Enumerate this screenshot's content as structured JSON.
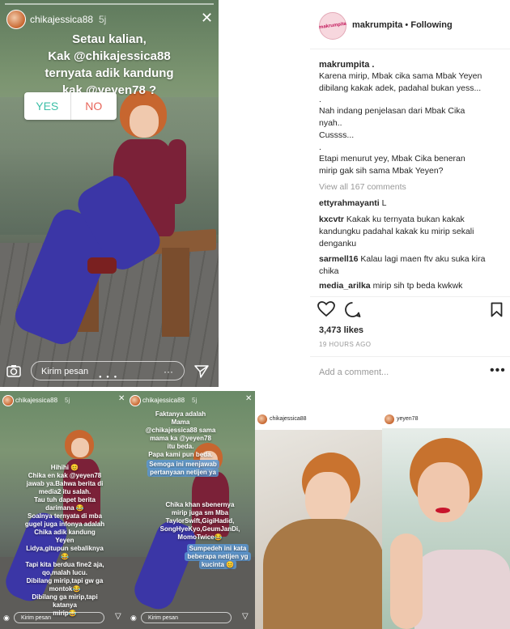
{
  "main_story": {
    "username": "chikajessica88",
    "time": "5j",
    "question": [
      "Setau kalian,",
      "Kak @chikajessica88",
      "ternyata adik kandung",
      "kak @yeyen78 ?"
    ],
    "poll_yes": "YES",
    "poll_no": "NO",
    "reply_placeholder": "Kirim pesan"
  },
  "post": {
    "username": "makrumpita",
    "follow_state": "Following",
    "logo_text": "makrumpita",
    "caption_user": "makrumpita .",
    "caption_lines": [
      "Karena mirip, Mbak cika sama Mbak Yeyen",
      "dibilang kakak adek, padahal bukan yess...",
      ".",
      "Nah indang penjelasan dari Mbak Cika",
      "nyah..",
      "Cussss...",
      ".",
      "Etapi menurut yey, Mbak Cika beneran",
      "mirip gak sih sama Mbak Yeyen?"
    ],
    "view_all": "View all 167 comments",
    "comments": [
      {
        "user": "ettyrahmayanti",
        "text": "L"
      },
      {
        "user": "kxcvtr",
        "text": "Kakak ku ternyata bukan kakak kandungku padahal kakak ku mirip sekali denganku"
      },
      {
        "user": "sarmell16",
        "text": "Kalau lagi maen ftv aku suka kira chika"
      },
      {
        "user": "media_arilka",
        "text": "mirip sih tp beda kwkwk"
      }
    ],
    "likes": "3,473 likes",
    "time_ago": "19 HOURS AGO",
    "add_comment": "Add a comment...",
    "more": "•••"
  },
  "story_b1": {
    "username": "chikajessica88",
    "time": "5j",
    "lines": [
      "Hihihi 😊",
      "Chika en kak @yeyen78",
      "jawab ya.Bahwa berita di",
      "media2 itu salah.",
      "Tau tuh dapet berita",
      "darimana 😂",
      "Soalnya ternyata di mba",
      "gugel juga infonya adalah",
      "Chika adik kandung Yeyen",
      "Lidya,gitupun sebaliknya😂",
      "Tapi kita berdua fine2 aja,",
      "qo,malah lucu.",
      "Dibilang mirip,tapi gw ga",
      "montok😂",
      "Dibilang ga mirip,tapi katanya",
      "mirip😂"
    ],
    "reply_placeholder": "Kirim pesan"
  },
  "story_b2": {
    "username": "chikajessica88",
    "time": "5j",
    "lines_top": [
      "Faktanya adalah",
      "Mama",
      "@chikajessica88 sama",
      "mama ka @yeyen78",
      "itu beda.",
      "Papa kami pun beda."
    ],
    "highlight_1": [
      "Semoga ini menjawab",
      "pertanyaan netijen ya"
    ],
    "lines_mid": [
      "Chika khan sbenernya",
      "mirip juga sm Mba",
      "TaylorSwift,GigiHadid,",
      "SongHyeKyo,GeumJanDi,",
      "MomoTwice😂"
    ],
    "highlight_2": [
      "Sumpedeh ini kata",
      "beberapa netijen yg",
      "kucinta 😊"
    ],
    "reply_placeholder": "Kirim pesan"
  },
  "selfie_1": {
    "username": "chikajessica88"
  },
  "selfie_2": {
    "username": "yeyen78"
  },
  "icons": [
    "close-icon",
    "camera-icon",
    "send-icon",
    "heart-icon",
    "comment-icon",
    "bookmark-icon",
    "more-icon"
  ],
  "colors": {
    "poll_yes": "#3dbfa7",
    "poll_no": "#e8665b",
    "highlight_blue": "#5a96d2"
  }
}
